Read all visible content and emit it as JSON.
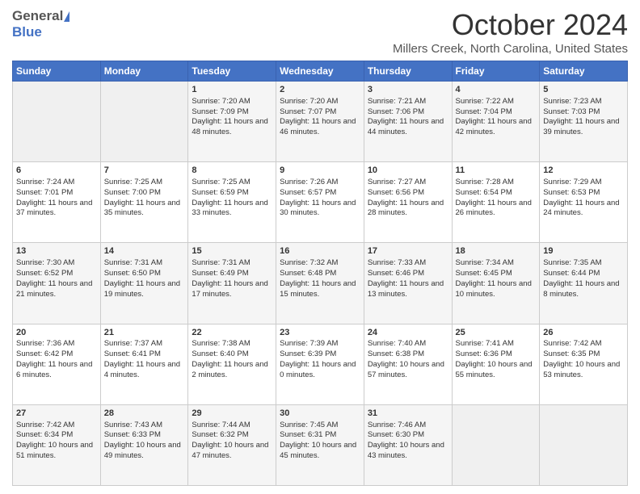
{
  "header": {
    "logo_general": "General",
    "logo_blue": "Blue",
    "month_title": "October 2024",
    "location": "Millers Creek, North Carolina, United States"
  },
  "days_of_week": [
    "Sunday",
    "Monday",
    "Tuesday",
    "Wednesday",
    "Thursday",
    "Friday",
    "Saturday"
  ],
  "weeks": [
    [
      {
        "day": "",
        "sunrise": "",
        "sunset": "",
        "daylight": ""
      },
      {
        "day": "",
        "sunrise": "",
        "sunset": "",
        "daylight": ""
      },
      {
        "day": "1",
        "sunrise": "Sunrise: 7:20 AM",
        "sunset": "Sunset: 7:09 PM",
        "daylight": "Daylight: 11 hours and 48 minutes."
      },
      {
        "day": "2",
        "sunrise": "Sunrise: 7:20 AM",
        "sunset": "Sunset: 7:07 PM",
        "daylight": "Daylight: 11 hours and 46 minutes."
      },
      {
        "day": "3",
        "sunrise": "Sunrise: 7:21 AM",
        "sunset": "Sunset: 7:06 PM",
        "daylight": "Daylight: 11 hours and 44 minutes."
      },
      {
        "day": "4",
        "sunrise": "Sunrise: 7:22 AM",
        "sunset": "Sunset: 7:04 PM",
        "daylight": "Daylight: 11 hours and 42 minutes."
      },
      {
        "day": "5",
        "sunrise": "Sunrise: 7:23 AM",
        "sunset": "Sunset: 7:03 PM",
        "daylight": "Daylight: 11 hours and 39 minutes."
      }
    ],
    [
      {
        "day": "6",
        "sunrise": "Sunrise: 7:24 AM",
        "sunset": "Sunset: 7:01 PM",
        "daylight": "Daylight: 11 hours and 37 minutes."
      },
      {
        "day": "7",
        "sunrise": "Sunrise: 7:25 AM",
        "sunset": "Sunset: 7:00 PM",
        "daylight": "Daylight: 11 hours and 35 minutes."
      },
      {
        "day": "8",
        "sunrise": "Sunrise: 7:25 AM",
        "sunset": "Sunset: 6:59 PM",
        "daylight": "Daylight: 11 hours and 33 minutes."
      },
      {
        "day": "9",
        "sunrise": "Sunrise: 7:26 AM",
        "sunset": "Sunset: 6:57 PM",
        "daylight": "Daylight: 11 hours and 30 minutes."
      },
      {
        "day": "10",
        "sunrise": "Sunrise: 7:27 AM",
        "sunset": "Sunset: 6:56 PM",
        "daylight": "Daylight: 11 hours and 28 minutes."
      },
      {
        "day": "11",
        "sunrise": "Sunrise: 7:28 AM",
        "sunset": "Sunset: 6:54 PM",
        "daylight": "Daylight: 11 hours and 26 minutes."
      },
      {
        "day": "12",
        "sunrise": "Sunrise: 7:29 AM",
        "sunset": "Sunset: 6:53 PM",
        "daylight": "Daylight: 11 hours and 24 minutes."
      }
    ],
    [
      {
        "day": "13",
        "sunrise": "Sunrise: 7:30 AM",
        "sunset": "Sunset: 6:52 PM",
        "daylight": "Daylight: 11 hours and 21 minutes."
      },
      {
        "day": "14",
        "sunrise": "Sunrise: 7:31 AM",
        "sunset": "Sunset: 6:50 PM",
        "daylight": "Daylight: 11 hours and 19 minutes."
      },
      {
        "day": "15",
        "sunrise": "Sunrise: 7:31 AM",
        "sunset": "Sunset: 6:49 PM",
        "daylight": "Daylight: 11 hours and 17 minutes."
      },
      {
        "day": "16",
        "sunrise": "Sunrise: 7:32 AM",
        "sunset": "Sunset: 6:48 PM",
        "daylight": "Daylight: 11 hours and 15 minutes."
      },
      {
        "day": "17",
        "sunrise": "Sunrise: 7:33 AM",
        "sunset": "Sunset: 6:46 PM",
        "daylight": "Daylight: 11 hours and 13 minutes."
      },
      {
        "day": "18",
        "sunrise": "Sunrise: 7:34 AM",
        "sunset": "Sunset: 6:45 PM",
        "daylight": "Daylight: 11 hours and 10 minutes."
      },
      {
        "day": "19",
        "sunrise": "Sunrise: 7:35 AM",
        "sunset": "Sunset: 6:44 PM",
        "daylight": "Daylight: 11 hours and 8 minutes."
      }
    ],
    [
      {
        "day": "20",
        "sunrise": "Sunrise: 7:36 AM",
        "sunset": "Sunset: 6:42 PM",
        "daylight": "Daylight: 11 hours and 6 minutes."
      },
      {
        "day": "21",
        "sunrise": "Sunrise: 7:37 AM",
        "sunset": "Sunset: 6:41 PM",
        "daylight": "Daylight: 11 hours and 4 minutes."
      },
      {
        "day": "22",
        "sunrise": "Sunrise: 7:38 AM",
        "sunset": "Sunset: 6:40 PM",
        "daylight": "Daylight: 11 hours and 2 minutes."
      },
      {
        "day": "23",
        "sunrise": "Sunrise: 7:39 AM",
        "sunset": "Sunset: 6:39 PM",
        "daylight": "Daylight: 11 hours and 0 minutes."
      },
      {
        "day": "24",
        "sunrise": "Sunrise: 7:40 AM",
        "sunset": "Sunset: 6:38 PM",
        "daylight": "Daylight: 10 hours and 57 minutes."
      },
      {
        "day": "25",
        "sunrise": "Sunrise: 7:41 AM",
        "sunset": "Sunset: 6:36 PM",
        "daylight": "Daylight: 10 hours and 55 minutes."
      },
      {
        "day": "26",
        "sunrise": "Sunrise: 7:42 AM",
        "sunset": "Sunset: 6:35 PM",
        "daylight": "Daylight: 10 hours and 53 minutes."
      }
    ],
    [
      {
        "day": "27",
        "sunrise": "Sunrise: 7:42 AM",
        "sunset": "Sunset: 6:34 PM",
        "daylight": "Daylight: 10 hours and 51 minutes."
      },
      {
        "day": "28",
        "sunrise": "Sunrise: 7:43 AM",
        "sunset": "Sunset: 6:33 PM",
        "daylight": "Daylight: 10 hours and 49 minutes."
      },
      {
        "day": "29",
        "sunrise": "Sunrise: 7:44 AM",
        "sunset": "Sunset: 6:32 PM",
        "daylight": "Daylight: 10 hours and 47 minutes."
      },
      {
        "day": "30",
        "sunrise": "Sunrise: 7:45 AM",
        "sunset": "Sunset: 6:31 PM",
        "daylight": "Daylight: 10 hours and 45 minutes."
      },
      {
        "day": "31",
        "sunrise": "Sunrise: 7:46 AM",
        "sunset": "Sunset: 6:30 PM",
        "daylight": "Daylight: 10 hours and 43 minutes."
      },
      {
        "day": "",
        "sunrise": "",
        "sunset": "",
        "daylight": ""
      },
      {
        "day": "",
        "sunrise": "",
        "sunset": "",
        "daylight": ""
      }
    ]
  ]
}
